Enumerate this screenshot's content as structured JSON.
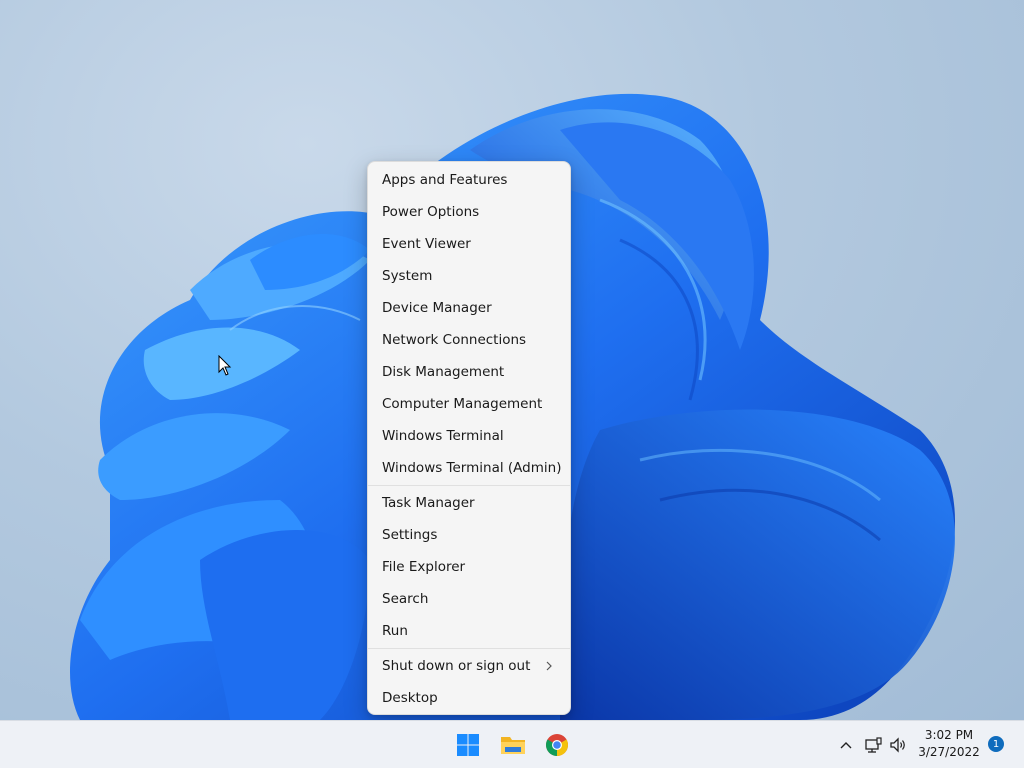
{
  "context_menu": {
    "groups": [
      [
        {
          "label": "Apps and Features"
        },
        {
          "label": "Power Options"
        },
        {
          "label": "Event Viewer"
        },
        {
          "label": "System"
        },
        {
          "label": "Device Manager"
        },
        {
          "label": "Network Connections"
        },
        {
          "label": "Disk Management"
        },
        {
          "label": "Computer Management"
        },
        {
          "label": "Windows Terminal"
        },
        {
          "label": "Windows Terminal (Admin)"
        }
      ],
      [
        {
          "label": "Task Manager"
        },
        {
          "label": "Settings"
        },
        {
          "label": "File Explorer"
        },
        {
          "label": "Search"
        },
        {
          "label": "Run"
        }
      ],
      [
        {
          "label": "Shut down or sign out",
          "submenu": true
        },
        {
          "label": "Desktop"
        }
      ]
    ]
  },
  "taskbar": {
    "pinned": [
      {
        "name": "start-button",
        "icon": "windows-logo-icon"
      },
      {
        "name": "file-explorer-button",
        "icon": "folder-icon"
      },
      {
        "name": "chrome-button",
        "icon": "chrome-icon"
      }
    ],
    "tray": {
      "icons": [
        "chevron-up-icon",
        "network-icon",
        "volume-icon"
      ],
      "time": "3:02 PM",
      "date": "3/27/2022",
      "notification_count": "1"
    }
  },
  "colors": {
    "accent": "#0f6cbd",
    "wallpaper_blue": "#1d5fe0"
  }
}
